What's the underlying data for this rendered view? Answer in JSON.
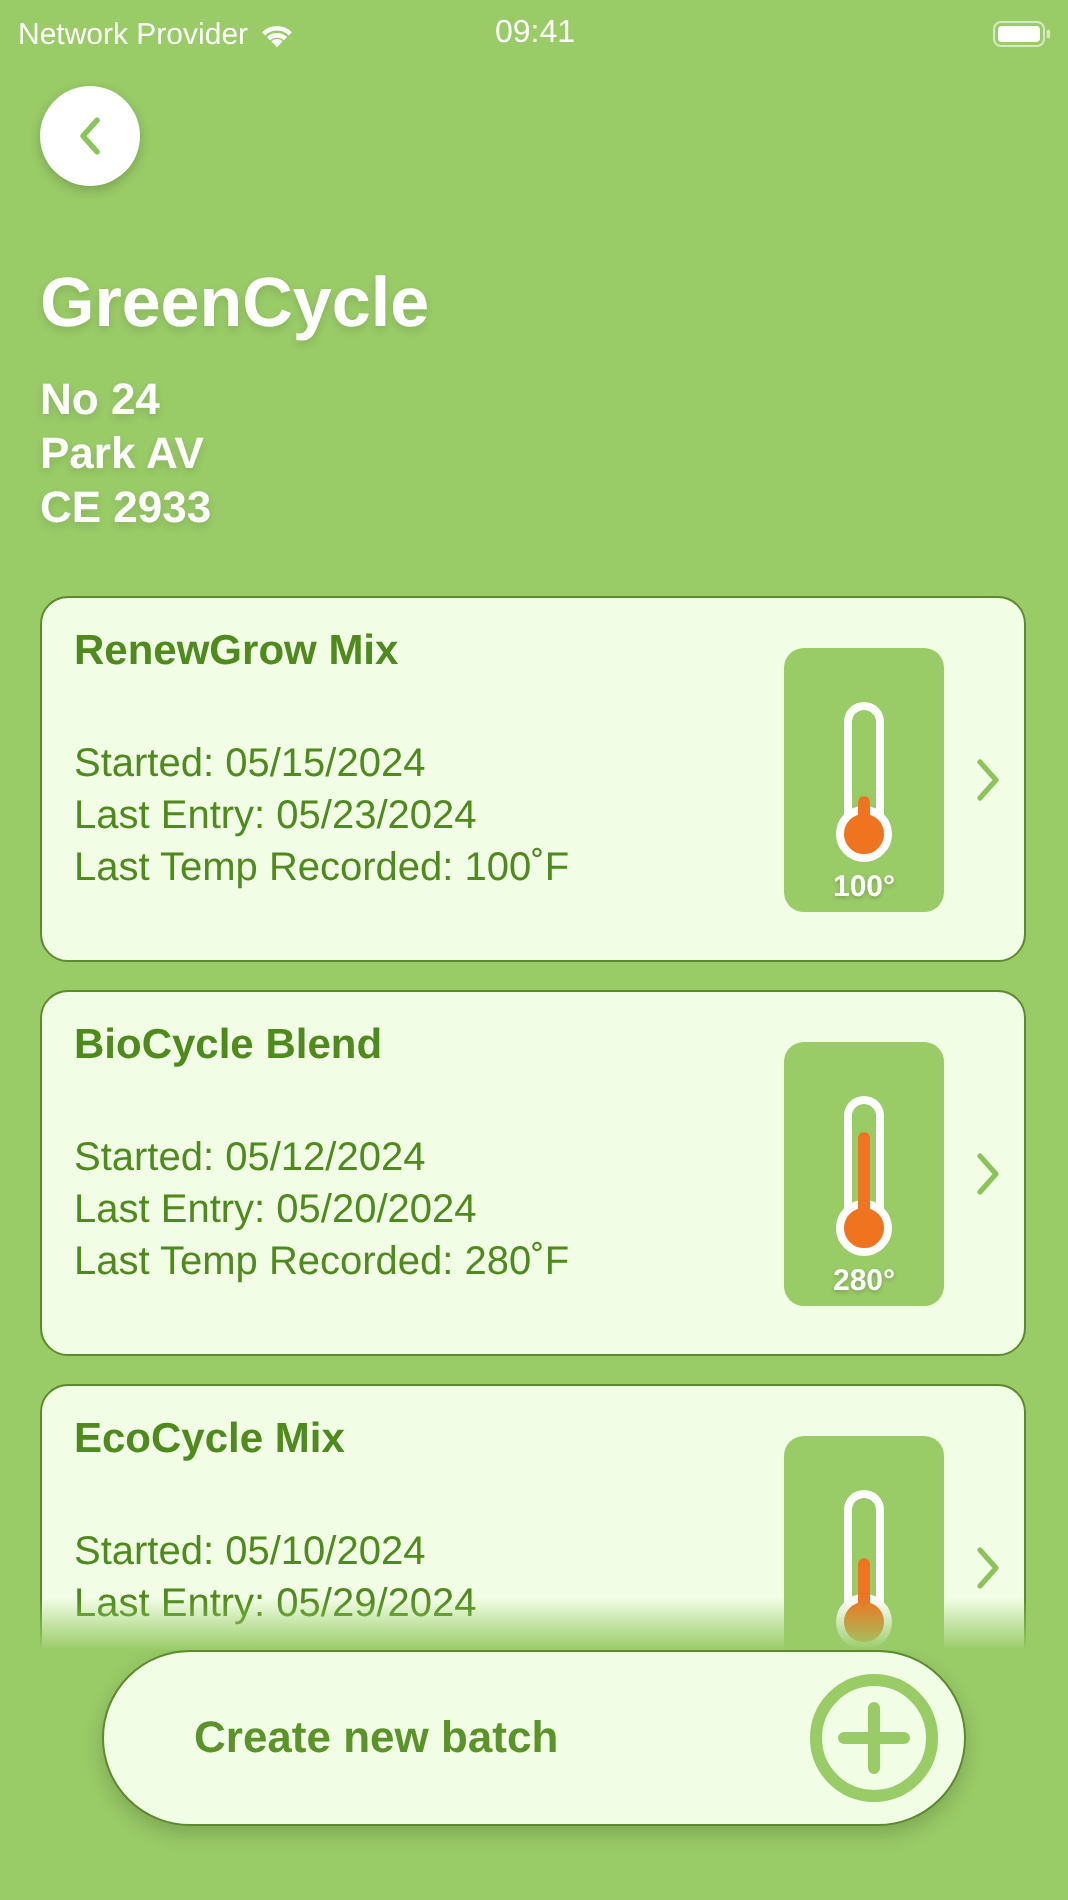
{
  "status_bar": {
    "carrier": "Network Provider",
    "time": "09:41"
  },
  "site": {
    "name": "GreenCycle",
    "address": [
      "No 24",
      "Park AV",
      "CE 2933"
    ]
  },
  "batches": [
    {
      "name": "RenewGrow Mix",
      "lines": [
        "Started: 05/15/2024",
        "Last Entry: 05/23/2024",
        "Last Temp Recorded: 100˚F"
      ],
      "level": 0.2,
      "reading": "100°"
    },
    {
      "name": "BioCycle Blend",
      "lines": [
        "Started: 05/12/2024",
        "Last Entry: 05/20/2024",
        "Last Temp Recorded: 280˚F"
      ],
      "level": 0.75,
      "reading": "280°"
    },
    {
      "name": "EcoCycle Mix",
      "lines": [
        "Started: 05/10/2024",
        "Last Entry: 05/29/2024"
      ],
      "level": 0.45
    }
  ],
  "create_button": {
    "label": "Create new batch"
  }
}
